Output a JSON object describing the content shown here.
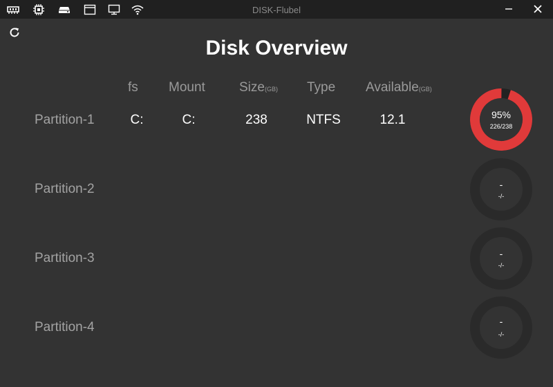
{
  "window": {
    "title": "DISK-Flubel",
    "icons": [
      "memory-icon",
      "cpu-icon",
      "disk-icon",
      "window-icon",
      "monitor-icon",
      "wifi-icon"
    ]
  },
  "page": {
    "title": "Disk Overview"
  },
  "columns": {
    "fs": "fs",
    "mount": "Mount",
    "size": "Size",
    "size_unit": "(GB)",
    "type": "Type",
    "available": "Available",
    "available_unit": "(GB)"
  },
  "partitions": [
    {
      "label": "Partition-1",
      "fs": "C:",
      "mount": "C:",
      "size": "238",
      "type": "NTFS",
      "available": "12.1",
      "usage_pct_text": "95%",
      "usage_ratio_text": "226/238",
      "usage_fraction": 0.95
    },
    {
      "label": "Partition-2",
      "usage_pct_text": "-",
      "usage_ratio_text": "-/-",
      "usage_fraction": 0
    },
    {
      "label": "Partition-3",
      "usage_pct_text": "-",
      "usage_ratio_text": "-/-",
      "usage_fraction": 0
    },
    {
      "label": "Partition-4",
      "usage_pct_text": "-",
      "usage_ratio_text": "-/-",
      "usage_fraction": 0
    }
  ],
  "colors": {
    "background": "#333333",
    "titlebar": "#202020",
    "gauge_track": "#2a2a2a",
    "gauge_used": "#e03a3a",
    "gauge_used_track": "#222222"
  }
}
